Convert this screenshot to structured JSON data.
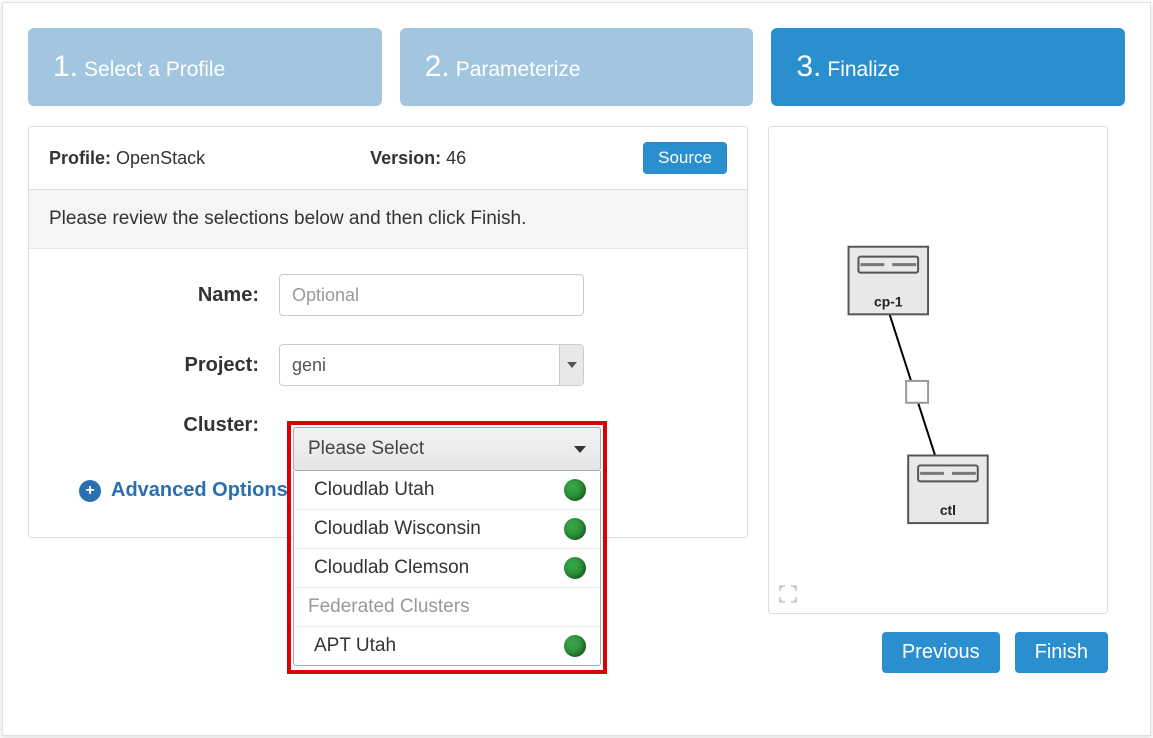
{
  "steps": {
    "s1": "Select a Profile",
    "s2": "Parameterize",
    "s3": "Finalize"
  },
  "header": {
    "profile_label": "Profile:",
    "profile_value": "OpenStack",
    "version_label": "Version:",
    "version_value": "46",
    "source_btn": "Source"
  },
  "review_text": "Please review the selections below and then click Finish.",
  "form": {
    "name_label": "Name:",
    "name_placeholder": "Optional",
    "name_value": "",
    "project_label": "Project:",
    "project_value": "geni",
    "cluster_label": "Cluster:",
    "cluster_selected": "Please Select"
  },
  "cluster_options": {
    "o1": "Cloudlab Utah",
    "o2": "Cloudlab Wisconsin",
    "o3": "Cloudlab Clemson",
    "group1": "Federated Clusters",
    "o4": "APT Utah"
  },
  "advanced_label": "Advanced Options",
  "topology": {
    "node1": "cp-1",
    "node2": "ctl"
  },
  "buttons": {
    "previous": "Previous",
    "finish": "Finish"
  }
}
